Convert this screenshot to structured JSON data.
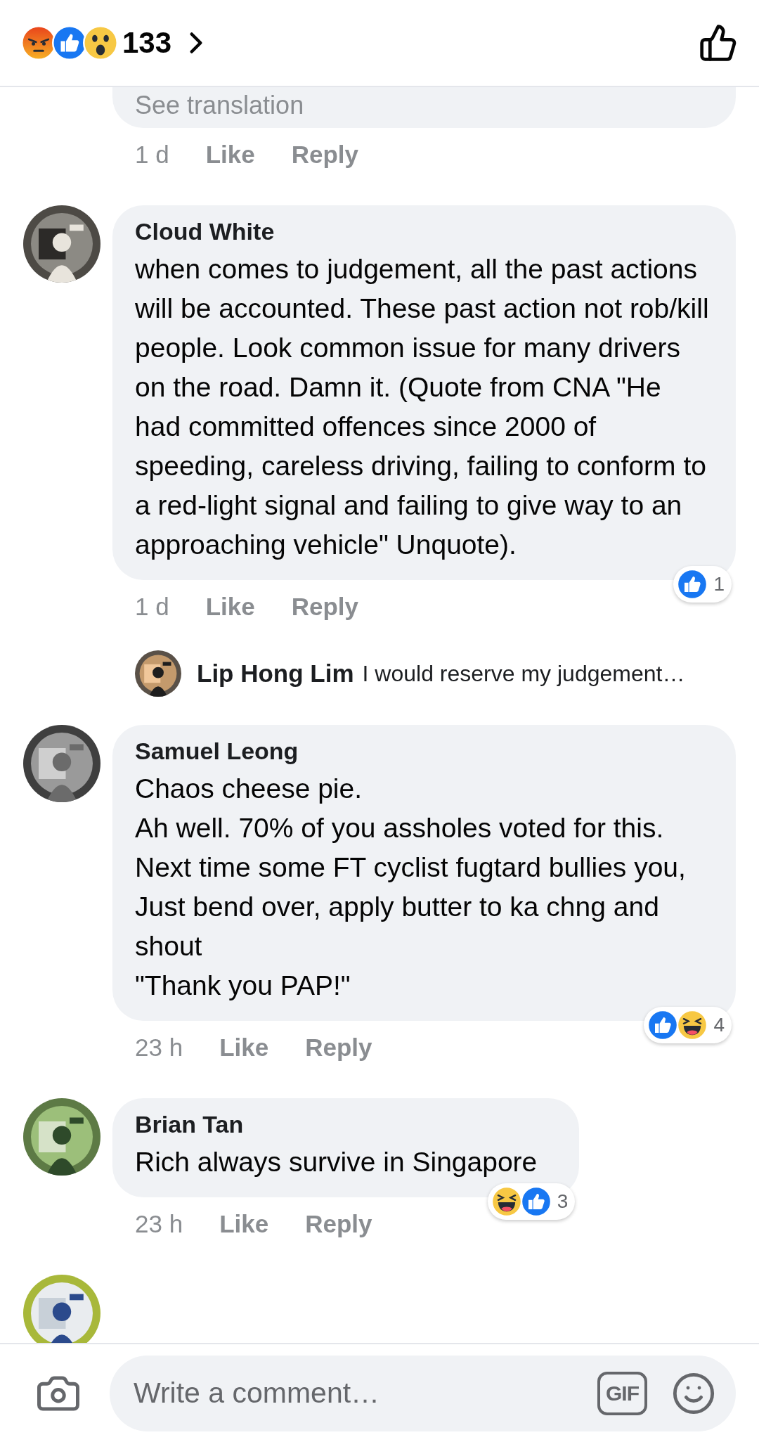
{
  "header": {
    "reactions": [
      {
        "kind": "angry"
      },
      {
        "kind": "like"
      },
      {
        "kind": "wow"
      }
    ],
    "count": "133"
  },
  "comments": [
    {
      "kind": "partial",
      "text": "See translation",
      "time": "1 d",
      "like": "Like",
      "reply": "Reply"
    },
    {
      "kind": "comment",
      "author": "Cloud White",
      "text": "when comes to judgement, all the past actions will be accounted. These past action not rob/kill people. Look common issue for many drivers on the road.  Damn it. (Quote from CNA \"He had committed offences since 2000 of speeding, careless driving, failing to conform to a red-light signal and failing to give way to an approaching vehicle\" Unquote).",
      "time": "1 d",
      "like": "Like",
      "reply": "Reply",
      "reactions": [
        {
          "kind": "like"
        }
      ],
      "reaction_count": "1"
    },
    {
      "kind": "reply_preview",
      "author": "Lip Hong Lim",
      "text": "I would reserve my judgement…"
    },
    {
      "kind": "comment",
      "author": "Samuel Leong",
      "text": "Chaos cheese pie.\nAh well. 70% of you assholes voted for this.\nNext time some FT cyclist fugtard bullies you,\nJust bend over, apply butter to ka chng and shout\n\"Thank you PAP!\"",
      "time": "23 h",
      "like": "Like",
      "reply": "Reply",
      "reactions": [
        {
          "kind": "like"
        },
        {
          "kind": "haha"
        }
      ],
      "reaction_count": "4"
    },
    {
      "kind": "comment",
      "author": "Brian Tan",
      "text": "Rich always survive in Singapore",
      "time": "23 h",
      "like": "Like",
      "reply": "Reply",
      "reactions": [
        {
          "kind": "haha"
        },
        {
          "kind": "like"
        }
      ],
      "reaction_count": "3"
    },
    {
      "kind": "avatar_only"
    }
  ],
  "composer": {
    "placeholder": "Write a comment…",
    "gif_label": "GIF"
  }
}
